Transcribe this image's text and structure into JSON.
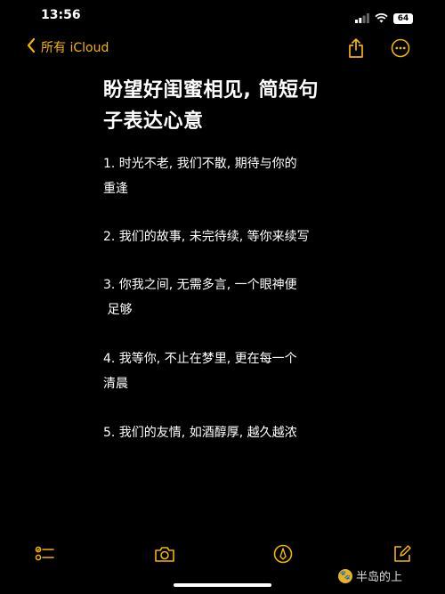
{
  "status_bar": {
    "time": "13:56",
    "battery": "64",
    "icons": [
      "signal-icon",
      "wifi-icon",
      "battery-icon"
    ]
  },
  "nav": {
    "back_label": "所有 iCloud",
    "accent_color": "#f5b400",
    "actions": [
      "share-icon",
      "more-icon"
    ]
  },
  "note": {
    "title_line1": "盼望好闺蜜相见, 简短句",
    "title_line2": "子表达心意",
    "items": [
      {
        "line1": "1. 时光不老, 我们不散, 期待与你的",
        "line2": "重逢"
      },
      {
        "line1": "2. 我们的故事, 未完待续, 等你来续写",
        "line2": ""
      },
      {
        "line1": "3. 你我之间, 无需多言, 一个眼神便",
        "line2": " 足够"
      },
      {
        "line1": "4. 我等你, 不止在梦里, 更在每一个",
        "line2": "清晨"
      },
      {
        "line1": "5. 我们的友情, 如酒醇厚, 越久越浓",
        "line2": ""
      }
    ]
  },
  "toolbar": {
    "icons": [
      "checklist-icon",
      "camera-icon",
      "pen-icon",
      "compose-icon"
    ]
  },
  "watermark": {
    "text": "半岛的上"
  }
}
